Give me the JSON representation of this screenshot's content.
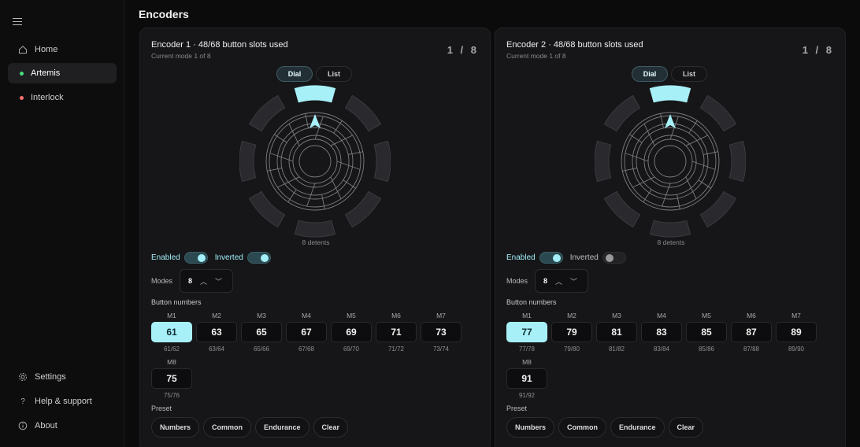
{
  "sidebar": {
    "menu_icon": "hamburger-icon",
    "items": [
      {
        "label": "Home",
        "icon": "home-icon"
      },
      {
        "label": "Artemis",
        "status_color": "#4ade80"
      },
      {
        "label": "Interlock",
        "status_color": "#f87171"
      }
    ],
    "bottom_items": [
      {
        "label": "Settings",
        "icon": "gear-icon"
      },
      {
        "label": "Help & support",
        "icon": "question-icon"
      },
      {
        "label": "About",
        "icon": "info-icon"
      }
    ]
  },
  "header": {
    "title": "Encoders"
  },
  "encoders": [
    {
      "title": "Encoder 1 · 48/68 button slots used",
      "subtitle": "Current mode 1 of 8",
      "page": "1 / 8",
      "view_tabs": [
        "Dial",
        "List"
      ],
      "detents": "8 detents",
      "enabled_label": "Enabled",
      "enabled": true,
      "inverted_label": "Inverted",
      "inverted": true,
      "modes_label": "Modes",
      "modes_value": "8",
      "button_numbers_label": "Button numbers",
      "buttons": [
        {
          "mode": "M1",
          "number": "61",
          "range": "61/62",
          "selected": true
        },
        {
          "mode": "M2",
          "number": "63",
          "range": "63/64"
        },
        {
          "mode": "M3",
          "number": "65",
          "range": "65/66"
        },
        {
          "mode": "M4",
          "number": "67",
          "range": "67/68"
        },
        {
          "mode": "M5",
          "number": "69",
          "range": "69/70"
        },
        {
          "mode": "M6",
          "number": "71",
          "range": "71/72"
        },
        {
          "mode": "M7",
          "number": "73",
          "range": "73/74"
        },
        {
          "mode": "M8",
          "number": "75",
          "range": "75/76"
        }
      ],
      "preset_label": "Preset",
      "presets": [
        "Numbers",
        "Common",
        "Endurance",
        "Clear"
      ]
    },
    {
      "title": "Encoder 2 · 48/68 button slots used",
      "subtitle": "Current mode 1 of 8",
      "page": "1 / 8",
      "view_tabs": [
        "Dial",
        "List"
      ],
      "detents": "8 detents",
      "enabled_label": "Enabled",
      "enabled": true,
      "inverted_label": "Inverted",
      "inverted": false,
      "modes_label": "Modes",
      "modes_value": "8",
      "button_numbers_label": "Button numbers",
      "buttons": [
        {
          "mode": "M1",
          "number": "77",
          "range": "77/78",
          "selected": true
        },
        {
          "mode": "M2",
          "number": "79",
          "range": "79/80"
        },
        {
          "mode": "M3",
          "number": "81",
          "range": "81/82"
        },
        {
          "mode": "M4",
          "number": "83",
          "range": "83/84"
        },
        {
          "mode": "M5",
          "number": "85",
          "range": "85/86"
        },
        {
          "mode": "M6",
          "number": "87",
          "range": "87/88"
        },
        {
          "mode": "M7",
          "number": "89",
          "range": "89/90"
        },
        {
          "mode": "M8",
          "number": "91",
          "range": "91/92"
        }
      ],
      "preset_label": "Preset",
      "presets": [
        "Numbers",
        "Common",
        "Endurance",
        "Clear"
      ]
    }
  ],
  "colors": {
    "accent": "#a8f0f8",
    "background": "#0b0b0c",
    "card": "#161618"
  }
}
